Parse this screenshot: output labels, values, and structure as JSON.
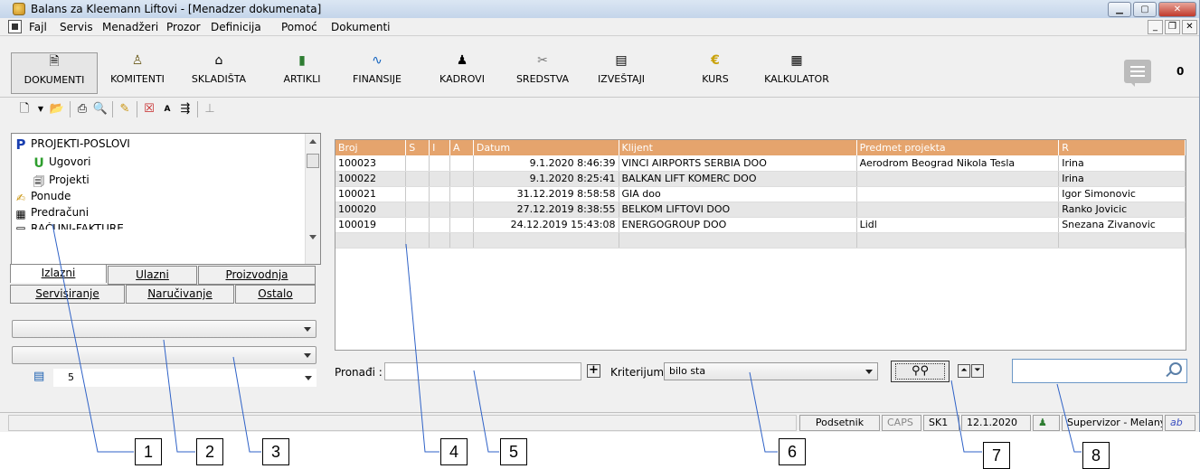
{
  "window": {
    "title": "Balans za Kleemann Liftovi - [Menadzer dokumenata]"
  },
  "menu": [
    "Fajl",
    "Servis",
    "Menadžeri",
    "Prozor",
    "Definicija",
    "Pomoć",
    "Dokumenti"
  ],
  "toolbar": {
    "buttons": [
      {
        "label": "DOKUMENTI",
        "icon": "document-icon"
      },
      {
        "label": "KOMITENTI",
        "icon": "person-icon"
      },
      {
        "label": "SKLADIŠTA",
        "icon": "warehouse-icon"
      },
      {
        "label": "ARTIKLI",
        "icon": "book-icon"
      },
      {
        "label": "FINANSIJE",
        "icon": "chart-icon"
      },
      {
        "label": "KADROVI",
        "icon": "people-icon"
      },
      {
        "label": "SREDSTVA",
        "icon": "tools-icon"
      },
      {
        "label": "IZVEŠTAJI",
        "icon": "report-icon"
      },
      {
        "label": "KURS",
        "icon": "euro-icon"
      },
      {
        "label": "KALKULATOR",
        "icon": "calculator-icon"
      }
    ],
    "notification_count": "0"
  },
  "tree": {
    "items": [
      {
        "label": "PROJEKTI-POSLOVI",
        "icon": "projects-icon"
      },
      {
        "label": "Ugovori",
        "icon": "contract-icon"
      },
      {
        "label": "Projekti",
        "icon": "project-icon"
      },
      {
        "label": "Ponude",
        "icon": "offer-icon"
      },
      {
        "label": "Predračuni",
        "icon": "proforma-icon"
      },
      {
        "label": "RAČUNI-FAKTURE",
        "icon": "invoice-icon"
      }
    ]
  },
  "tabs": {
    "row1": [
      "Izlazni",
      "Ulazni",
      "Proizvodnja"
    ],
    "row2": [
      "Servisiranje",
      "Naručivanje",
      "Ostalo"
    ]
  },
  "left_filter": {
    "value": "5"
  },
  "grid": {
    "columns": [
      "Broj",
      "S",
      "I",
      "A",
      "Datum",
      "Klijent",
      "Predmet projekta",
      "R"
    ],
    "rows": [
      [
        "100023",
        "",
        "",
        "",
        "9.1.2020 8:46:39",
        "VINCI AIRPORTS SERBIA DOO",
        "Aerodrom Beograd Nikola Tesla",
        "Irina"
      ],
      [
        "100022",
        "",
        "",
        "",
        "9.1.2020 8:25:41",
        "BALKAN LIFT KOMERC DOO",
        "",
        "Irina"
      ],
      [
        "100021",
        "",
        "",
        "",
        "31.12.2019 8:58:58",
        "GIA doo",
        "",
        "Igor Simonovic"
      ],
      [
        "100020",
        "",
        "",
        "",
        "27.12.2019 8:38:55",
        "BELKOM LIFTOVI DOO",
        "",
        "Ranko Jovicic"
      ],
      [
        "100019",
        "",
        "",
        "",
        "24.12.2019 15:43:08",
        "ENERGOGROUP DOO",
        "Lidl",
        "Snezana Zivanovic"
      ]
    ]
  },
  "find": {
    "label": "Pronađi :",
    "criteria_label": "Kriterijum :",
    "criteria_value": "bilo sta"
  },
  "status": {
    "reminder": "Podsetnik",
    "caps": "CAPS",
    "sk": "SK1",
    "date": "12.1.2020",
    "user": "Supervizor - Melany"
  },
  "callouts": [
    "1",
    "2",
    "3",
    "4",
    "5",
    "6",
    "7",
    "8"
  ],
  "colors": {
    "grid_header": "#e5a46d",
    "grid_alt_row": "#e6e6e6",
    "titlebar": "#c4d5ea"
  }
}
